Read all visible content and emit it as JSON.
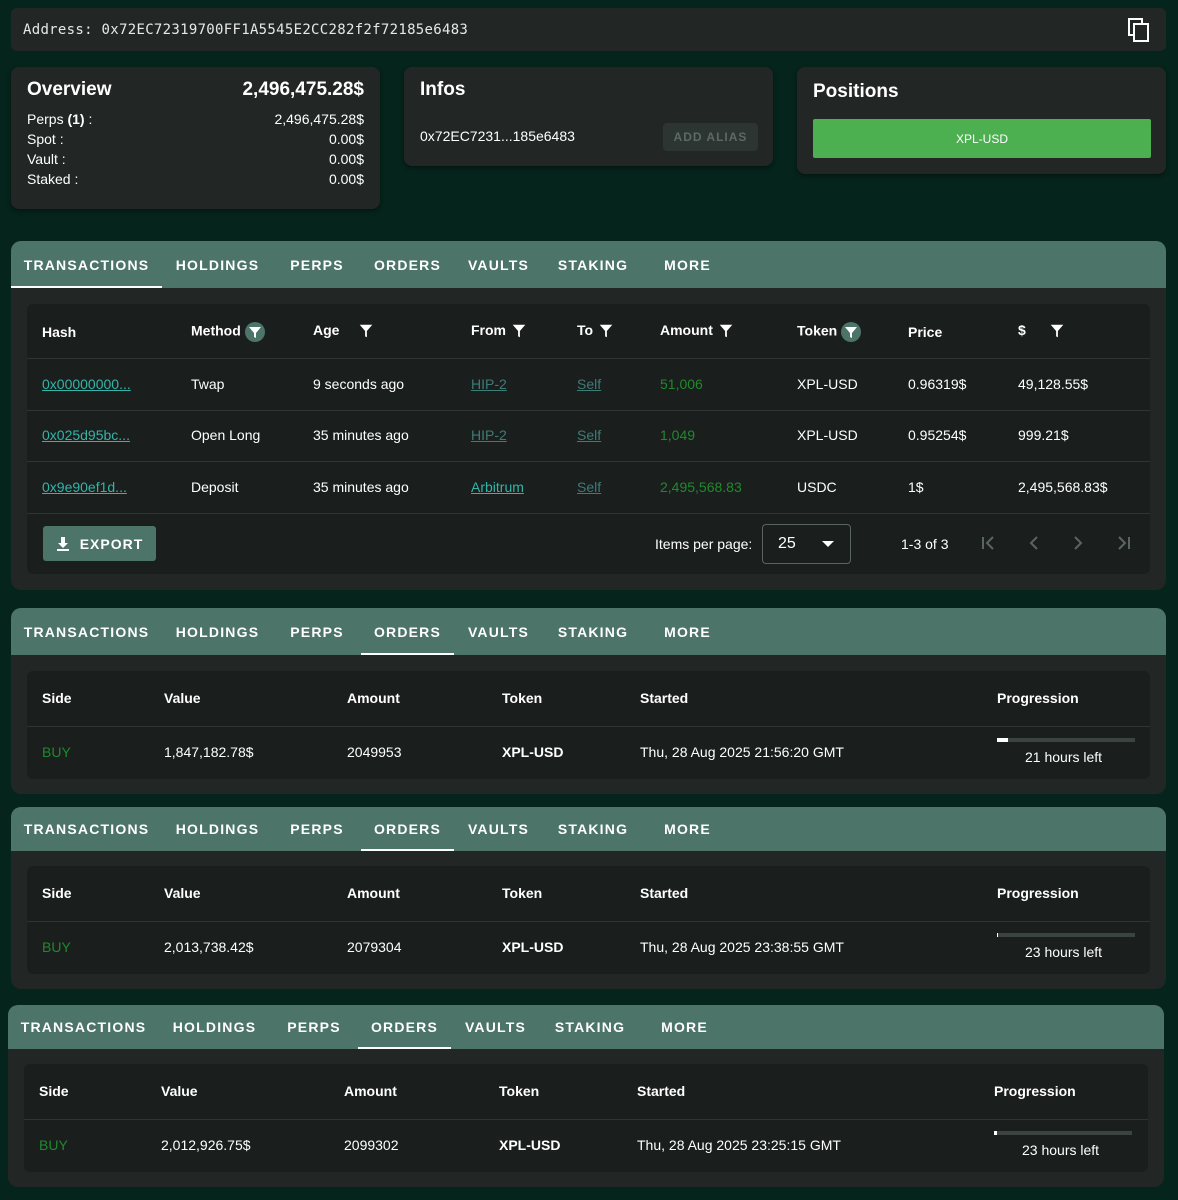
{
  "address": {
    "text": "Address: 0x72EC72319700FF1A5545E2CC282f2f72185e6483",
    "copy_icon": "copy-icon"
  },
  "overview": {
    "title": "Overview",
    "total": "2,496,475.28$",
    "rows": [
      {
        "label_pre": "Perps ",
        "label_bold": "(1)",
        "label_post": " :",
        "value": "2,496,475.28$"
      },
      {
        "label_pre": "Spot :",
        "label_bold": "",
        "label_post": "",
        "value": "0.00$"
      },
      {
        "label_pre": "Vault :",
        "label_bold": "",
        "label_post": "",
        "value": "0.00$"
      },
      {
        "label_pre": "Staked :",
        "label_bold": "",
        "label_post": "",
        "value": "0.00$"
      }
    ]
  },
  "infos": {
    "title": "Infos",
    "address_short": "0x72EC7231...185e6483",
    "add_alias": "ADD ALIAS"
  },
  "positions": {
    "title": "Positions",
    "items": [
      "XPL-USD"
    ]
  },
  "tabs": [
    "TRANSACTIONS",
    "HOLDINGS",
    "PERPS",
    "ORDERS",
    "VAULTS",
    "STAKING",
    "MORE"
  ],
  "transactions": {
    "active_tab": "TRANSACTIONS",
    "headers": [
      "Hash",
      "Method",
      "Age",
      "From",
      "To",
      "Amount",
      "Token",
      "Price",
      "$"
    ],
    "rows": [
      {
        "hash": "0x00000000...",
        "method": "Twap",
        "age": "9 seconds ago",
        "from": "HIP-2",
        "to": "Self",
        "amount": "51,006",
        "token": "XPL-USD",
        "price": "0.96319$",
        "usd": "49,128.55$"
      },
      {
        "hash": "0x025d95bc...",
        "method": "Open Long",
        "age": "35 minutes ago",
        "from": "HIP-2",
        "to": "Self",
        "amount": "1,049",
        "token": "XPL-USD",
        "price": "0.95254$",
        "usd": "999.21$"
      },
      {
        "hash": "0x9e90ef1d...",
        "method": "Deposit",
        "age": "35 minutes ago",
        "from": "Arbitrum",
        "to": "Self",
        "amount": "2,495,568.83",
        "token": "USDC",
        "price": "1$",
        "usd": "2,495,568.83$"
      }
    ],
    "export_label": "EXPORT",
    "items_per_page_label": "Items per page:",
    "items_per_page_value": "25",
    "range_label": "1-3 of 3"
  },
  "orders_headers": [
    "Side",
    "Value",
    "Amount",
    "Token",
    "Started",
    "Progression"
  ],
  "orders": [
    {
      "side": "BUY",
      "value": "1,847,182.78$",
      "amount": "2049953",
      "token": "XPL-USD",
      "started": "Thu, 28 Aug 2025 21:56:20 GMT",
      "progress_fraction": 0.08,
      "time_left": "21 hours left"
    },
    {
      "side": "BUY",
      "value": "2,013,738.42$",
      "amount": "2079304",
      "token": "XPL-USD",
      "started": "Thu, 28 Aug 2025 23:38:55 GMT",
      "progress_fraction": 0.01,
      "time_left": "23 hours left"
    },
    {
      "side": "BUY",
      "value": "2,012,926.75$",
      "amount": "2099302",
      "token": "XPL-USD",
      "started": "Thu, 28 Aug 2025 23:25:15 GMT",
      "progress_fraction": 0.02,
      "time_left": "23 hours left"
    }
  ],
  "colors": {
    "background": "#05241b",
    "card": "#222726",
    "tabbar": "#4d7469",
    "position_green": "#4caf50",
    "buy_green": "#1f8a2c",
    "link_teal": "#32b5a8"
  }
}
